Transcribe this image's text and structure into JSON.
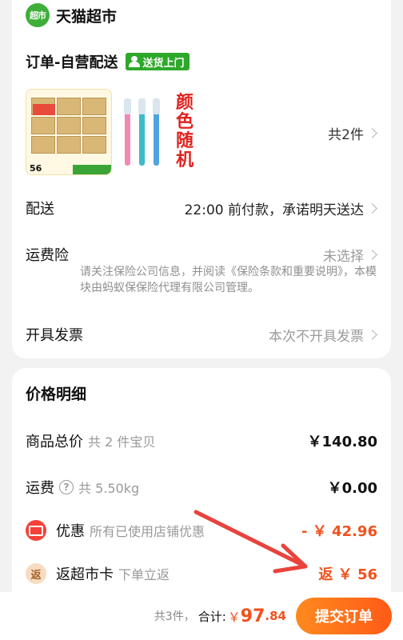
{
  "store": {
    "logo_text": "超市",
    "name": "天猫超市"
  },
  "order": {
    "title": "订单-自营配送",
    "delivery_badge": "送货上门"
  },
  "products": {
    "thumb1_price": "56",
    "random_color_text": "颜色随机",
    "count_text": "共2件"
  },
  "rows": {
    "delivery": {
      "label": "配送",
      "value": "22:00 前付款，承诺明天送达"
    },
    "insurance": {
      "label": "运费险",
      "value": "未选择",
      "note": "请关注保险公司信息，并阅读《保险条款和重要说明》，本模块由蚂蚁保保险代理有限公司管理。"
    },
    "invoice": {
      "label": "开具发票",
      "value": "本次不开具发票"
    }
  },
  "price": {
    "title": "价格明细",
    "goods": {
      "label": "商品总价",
      "sub": "共 2 件宝贝",
      "value": "￥140.80"
    },
    "shipping": {
      "label": "运费",
      "sub": "共 5.50kg",
      "value": "￥0.00"
    },
    "discount": {
      "label": "优惠",
      "sub": "所有已使用店铺优惠",
      "value": "- ￥ 42.96"
    },
    "card": {
      "icon_text": "返",
      "label": "返超市卡",
      "sub": "下单立返",
      "value": "返 ￥ 56"
    }
  },
  "bottom": {
    "count": "共3件，",
    "total_label": "合计:",
    "currency": "￥",
    "total_int": "97",
    "total_dec": ".84",
    "submit": "提交订单"
  },
  "colors": {
    "brand_green": "#3fae3a",
    "accent_orange": "#f2511d",
    "arrow_red": "#e8433c"
  }
}
